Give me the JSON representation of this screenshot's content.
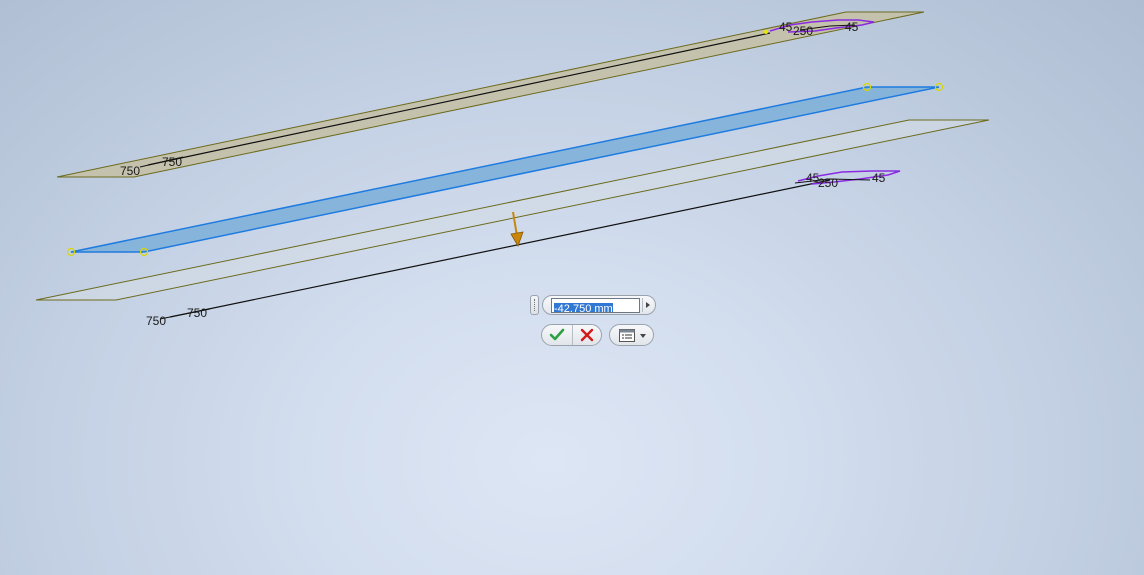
{
  "viewport": {
    "top_sketch": {
      "dims": {
        "left_a": "750",
        "left_b": "750",
        "right_a": "45",
        "right_b": "250",
        "right_c": "45"
      }
    },
    "bottom_sketch": {
      "dims": {
        "left_a": "750",
        "left_b": "750",
        "right_a": "45",
        "right_b": "250",
        "right_c": "45"
      }
    }
  },
  "mini_toolbar": {
    "distance_value": "-42.750 mm",
    "ok_icon": "checkmark-icon",
    "cancel_icon": "x-icon",
    "options_icon": "list-dropdown-icon"
  },
  "colors": {
    "selected_face": "#7fb0d8",
    "selected_edge": "#1e7be0",
    "sketch_edge": "#6b6a1c",
    "profile_fill": "#c4c1ad",
    "constraint_purple": "#8a2be2",
    "direction_arrow": "#c8860a",
    "ok_green": "#2ea043",
    "cancel_red": "#d11a1a"
  }
}
